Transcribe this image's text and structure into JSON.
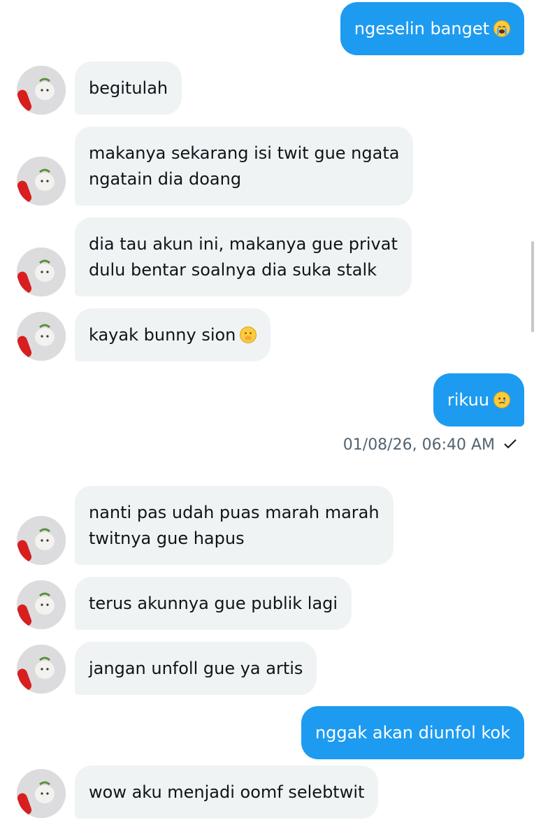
{
  "messages": {
    "m1": {
      "text": "ngeselin banget",
      "emoji": "loudly-crying-face"
    },
    "m2": {
      "text": "begitulah"
    },
    "m3": {
      "line1": "makanya sekarang isi twit gue ngata",
      "line2": "ngatain dia doang"
    },
    "m4": {
      "line1": "dia tau akun ini, makanya gue privat",
      "line2": "dulu bentar soalnya dia suka stalk"
    },
    "m5": {
      "text": "kayak bunny sion",
      "emoji": "face-with-hand-over-mouth"
    },
    "m6": {
      "text": "rikuu",
      "emoji": "face-holding-back-tears"
    },
    "m7": {
      "line1": "nanti pas udah puas marah marah",
      "line2": "twitnya gue hapus"
    },
    "m8": {
      "text": "terus akunnya gue publik lagi"
    },
    "m9": {
      "text": "jangan unfoll gue ya artis"
    },
    "m10": {
      "text": "nggak akan diunfol kok"
    },
    "m11": {
      "text": "wow aku menjadi oomf selebtwit"
    }
  },
  "timestamp": {
    "text": "01/08/26, 06:40 AM",
    "status_icon": "check-icon"
  },
  "colors": {
    "sent_bubble": "#1d9bf0",
    "received_bubble": "#eff3f4",
    "timestamp": "#536471"
  }
}
